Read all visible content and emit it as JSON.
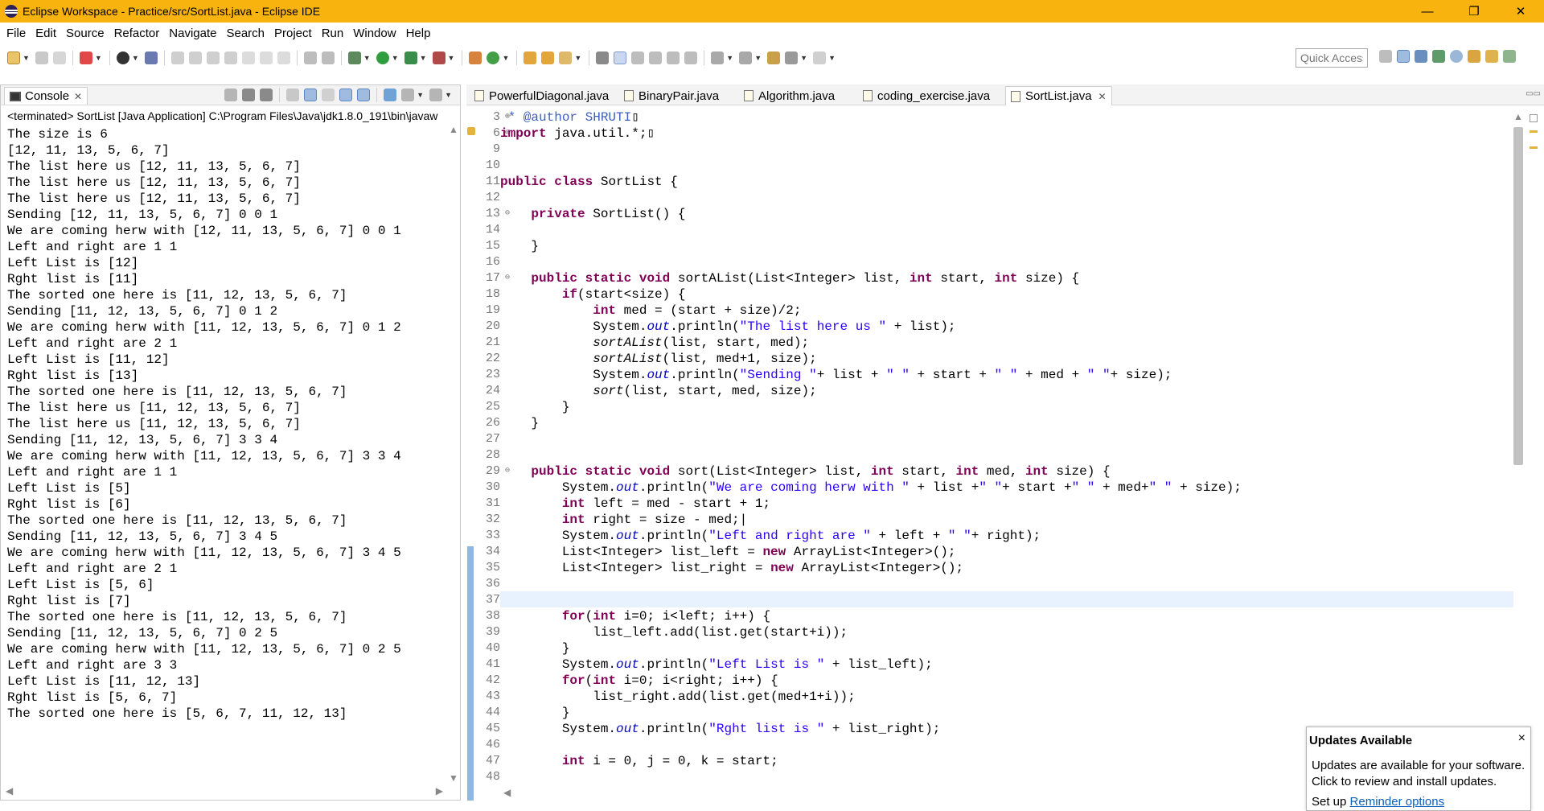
{
  "window": {
    "title": "Eclipse Workspace - Practice/src/SortList.java - Eclipse IDE",
    "min_glyph": "—",
    "max_glyph": "❐",
    "close_glyph": "✕"
  },
  "menu": [
    "File",
    "Edit",
    "Source",
    "Refactor",
    "Navigate",
    "Search",
    "Project",
    "Run",
    "Window",
    "Help"
  ],
  "toolbar": {
    "quick_access_placeholder": "Quick Access"
  },
  "console": {
    "tab_label": "Console",
    "close_glyph": "✕",
    "header": "<terminated> SortList [Java Application] C:\\Program Files\\Java\\jdk1.8.0_191\\bin\\javaw",
    "lines": [
      "The size is 6",
      "[12, 11, 13, 5, 6, 7]",
      "The list here us [12, 11, 13, 5, 6, 7]",
      "The list here us [12, 11, 13, 5, 6, 7]",
      "The list here us [12, 11, 13, 5, 6, 7]",
      "Sending [12, 11, 13, 5, 6, 7] 0 0 1",
      "We are coming herw with [12, 11, 13, 5, 6, 7] 0 0 1",
      "Left and right are 1 1",
      "Left List is [12]",
      "Rght list is [11]",
      "The sorted one here is [11, 12, 13, 5, 6, 7]",
      "Sending [11, 12, 13, 5, 6, 7] 0 1 2",
      "We are coming herw with [11, 12, 13, 5, 6, 7] 0 1 2",
      "Left and right are 2 1",
      "Left List is [11, 12]",
      "Rght list is [13]",
      "The sorted one here is [11, 12, 13, 5, 6, 7]",
      "The list here us [11, 12, 13, 5, 6, 7]",
      "The list here us [11, 12, 13, 5, 6, 7]",
      "Sending [11, 12, 13, 5, 6, 7] 3 3 4",
      "We are coming herw with [11, 12, 13, 5, 6, 7] 3 3 4",
      "Left and right are 1 1",
      "Left List is [5]",
      "Rght list is [6]",
      "The sorted one here is [11, 12, 13, 5, 6, 7]",
      "Sending [11, 12, 13, 5, 6, 7] 3 4 5",
      "We are coming herw with [11, 12, 13, 5, 6, 7] 3 4 5",
      "Left and right are 2 1",
      "Left List is [5, 6]",
      "Rght list is [7]",
      "The sorted one here is [11, 12, 13, 5, 6, 7]",
      "Sending [11, 12, 13, 5, 6, 7] 0 2 5",
      "We are coming herw with [11, 12, 13, 5, 6, 7] 0 2 5",
      "Left and right are 3 3",
      "Left List is [11, 12, 13]",
      "Rght list is [5, 6, 7]",
      "The sorted one here is [5, 6, 7, 11, 12, 13]"
    ]
  },
  "editor": {
    "tabs": [
      {
        "label": "PowerfulDiagonal.java",
        "active": false
      },
      {
        "label": "BinaryPair.java",
        "active": false
      },
      {
        "label": "Algorithm.java",
        "active": false
      },
      {
        "label": "coding_exercise.java",
        "active": false
      },
      {
        "label": "SortList.java",
        "active": true
      }
    ],
    "tab_close_glyph": "✕",
    "current_line_number": "32",
    "lines": [
      {
        "n": "3",
        "fold": "⊕",
        "tokens": [
          {
            "t": " * @author SHRUTI",
            "c": "cm"
          },
          {
            "t": "▯",
            "c": ""
          }
        ]
      },
      {
        "n": "6",
        "fold": "⊕",
        "tokens": [
          {
            "t": "import",
            "c": "kw"
          },
          {
            "t": " java.util.*;",
            "c": ""
          },
          {
            "t": "▯",
            "c": ""
          }
        ]
      },
      {
        "n": "9",
        "tokens": []
      },
      {
        "n": "10",
        "tokens": []
      },
      {
        "n": "11",
        "tokens": [
          {
            "t": "public",
            "c": "kw"
          },
          {
            "t": " ",
            "c": ""
          },
          {
            "t": "class",
            "c": "kw"
          },
          {
            "t": " SortList {",
            "c": ""
          }
        ]
      },
      {
        "n": "12",
        "tokens": []
      },
      {
        "n": "13",
        "fold": "⊖",
        "tokens": [
          {
            "t": "    ",
            "c": ""
          },
          {
            "t": "private",
            "c": "kw"
          },
          {
            "t": " SortList() {",
            "c": ""
          }
        ]
      },
      {
        "n": "14",
        "tokens": []
      },
      {
        "n": "15",
        "tokens": [
          {
            "t": "    }",
            "c": ""
          }
        ]
      },
      {
        "n": "16",
        "tokens": []
      },
      {
        "n": "17",
        "fold": "⊖",
        "tokens": [
          {
            "t": "    ",
            "c": ""
          },
          {
            "t": "public",
            "c": "kw"
          },
          {
            "t": " ",
            "c": ""
          },
          {
            "t": "static",
            "c": "kw"
          },
          {
            "t": " ",
            "c": ""
          },
          {
            "t": "void",
            "c": "kw"
          },
          {
            "t": " sortAList(List<Integer> list, ",
            "c": ""
          },
          {
            "t": "int",
            "c": "kw"
          },
          {
            "t": " start, ",
            "c": ""
          },
          {
            "t": "int",
            "c": "kw"
          },
          {
            "t": " size) {",
            "c": ""
          }
        ]
      },
      {
        "n": "18",
        "tokens": [
          {
            "t": "        ",
            "c": ""
          },
          {
            "t": "if",
            "c": "kw"
          },
          {
            "t": "(start<size) {",
            "c": ""
          }
        ]
      },
      {
        "n": "19",
        "tokens": [
          {
            "t": "            ",
            "c": ""
          },
          {
            "t": "int",
            "c": "kw"
          },
          {
            "t": " med = (start + size)/2;",
            "c": ""
          }
        ]
      },
      {
        "n": "20",
        "tokens": [
          {
            "t": "            System.",
            "c": ""
          },
          {
            "t": "out",
            "c": "fld"
          },
          {
            "t": ".println(",
            "c": ""
          },
          {
            "t": "\"The list here us \"",
            "c": "str"
          },
          {
            "t": " + list);",
            "c": ""
          }
        ]
      },
      {
        "n": "21",
        "tokens": [
          {
            "t": "            ",
            "c": ""
          },
          {
            "t": "sortAList",
            "c": "smeth"
          },
          {
            "t": "(list, start, med);",
            "c": ""
          }
        ]
      },
      {
        "n": "22",
        "tokens": [
          {
            "t": "            ",
            "c": ""
          },
          {
            "t": "sortAList",
            "c": "smeth"
          },
          {
            "t": "(list, med+1, size);",
            "c": ""
          }
        ]
      },
      {
        "n": "23",
        "tokens": [
          {
            "t": "            System.",
            "c": ""
          },
          {
            "t": "out",
            "c": "fld"
          },
          {
            "t": ".println(",
            "c": ""
          },
          {
            "t": "\"Sending \"",
            "c": "str"
          },
          {
            "t": "+ list + ",
            "c": ""
          },
          {
            "t": "\" \"",
            "c": "str"
          },
          {
            "t": " + start + ",
            "c": ""
          },
          {
            "t": "\" \"",
            "c": "str"
          },
          {
            "t": " + med + ",
            "c": ""
          },
          {
            "t": "\" \"",
            "c": "str"
          },
          {
            "t": "+ size);",
            "c": ""
          }
        ]
      },
      {
        "n": "24",
        "tokens": [
          {
            "t": "            ",
            "c": ""
          },
          {
            "t": "sort",
            "c": "smeth"
          },
          {
            "t": "(list, start, med, size);",
            "c": ""
          }
        ]
      },
      {
        "n": "25",
        "tokens": [
          {
            "t": "        }",
            "c": ""
          }
        ]
      },
      {
        "n": "26",
        "tokens": [
          {
            "t": "    }",
            "c": ""
          }
        ]
      },
      {
        "n": "27",
        "tokens": []
      },
      {
        "n": "28",
        "tokens": []
      },
      {
        "n": "29",
        "fold": "⊖",
        "tokens": [
          {
            "t": "    ",
            "c": ""
          },
          {
            "t": "public",
            "c": "kw"
          },
          {
            "t": " ",
            "c": ""
          },
          {
            "t": "static",
            "c": "kw"
          },
          {
            "t": " ",
            "c": ""
          },
          {
            "t": "void",
            "c": "kw"
          },
          {
            "t": " sort(List<Integer> list, ",
            "c": ""
          },
          {
            "t": "int",
            "c": "kw"
          },
          {
            "t": " start, ",
            "c": ""
          },
          {
            "t": "int",
            "c": "kw"
          },
          {
            "t": " med, ",
            "c": ""
          },
          {
            "t": "int",
            "c": "kw"
          },
          {
            "t": " size) {",
            "c": ""
          }
        ]
      },
      {
        "n": "30",
        "tokens": [
          {
            "t": "        System.",
            "c": ""
          },
          {
            "t": "out",
            "c": "fld"
          },
          {
            "t": ".println(",
            "c": ""
          },
          {
            "t": "\"We are coming herw with \"",
            "c": "str"
          },
          {
            "t": " + list +",
            "c": ""
          },
          {
            "t": "\" \"",
            "c": "str"
          },
          {
            "t": "+ start +",
            "c": ""
          },
          {
            "t": "\" \"",
            "c": "str"
          },
          {
            "t": " + med+",
            "c": ""
          },
          {
            "t": "\" \"",
            "c": "str"
          },
          {
            "t": " + size);",
            "c": ""
          }
        ]
      },
      {
        "n": "31",
        "tokens": [
          {
            "t": "        ",
            "c": ""
          },
          {
            "t": "int",
            "c": "kw"
          },
          {
            "t": " left = med - start + 1;",
            "c": ""
          }
        ]
      },
      {
        "n": "32",
        "tokens": [
          {
            "t": "        ",
            "c": ""
          },
          {
            "t": "int",
            "c": "kw"
          },
          {
            "t": " right = size - med;",
            "c": ""
          },
          {
            "t": "|",
            "c": ""
          }
        ]
      },
      {
        "n": "33",
        "tokens": [
          {
            "t": "        System.",
            "c": ""
          },
          {
            "t": "out",
            "c": "fld"
          },
          {
            "t": ".println(",
            "c": ""
          },
          {
            "t": "\"Left and right are \"",
            "c": "str"
          },
          {
            "t": " + left + ",
            "c": ""
          },
          {
            "t": "\" \"",
            "c": "str"
          },
          {
            "t": "+ right);",
            "c": ""
          }
        ]
      },
      {
        "n": "34",
        "tokens": [
          {
            "t": "        List<Integer> list_left = ",
            "c": ""
          },
          {
            "t": "new",
            "c": "kw"
          },
          {
            "t": " ArrayList<Integer>();",
            "c": ""
          }
        ]
      },
      {
        "n": "35",
        "tokens": [
          {
            "t": "        List<Integer> list_right = ",
            "c": ""
          },
          {
            "t": "new",
            "c": "kw"
          },
          {
            "t": " ArrayList<Integer>();",
            "c": ""
          }
        ]
      },
      {
        "n": "36",
        "tokens": []
      },
      {
        "n": "37",
        "tokens": []
      },
      {
        "n": "38",
        "tokens": [
          {
            "t": "        ",
            "c": ""
          },
          {
            "t": "for",
            "c": "kw"
          },
          {
            "t": "(",
            "c": ""
          },
          {
            "t": "int",
            "c": "kw"
          },
          {
            "t": " i=0; i<left; i++) {",
            "c": ""
          }
        ]
      },
      {
        "n": "39",
        "tokens": [
          {
            "t": "            list_left.add(list.get(start+i));",
            "c": ""
          }
        ]
      },
      {
        "n": "40",
        "tokens": [
          {
            "t": "        }",
            "c": ""
          }
        ]
      },
      {
        "n": "41",
        "tokens": [
          {
            "t": "        System.",
            "c": ""
          },
          {
            "t": "out",
            "c": "fld"
          },
          {
            "t": ".println(",
            "c": ""
          },
          {
            "t": "\"Left List is \"",
            "c": "str"
          },
          {
            "t": " + list_left);",
            "c": ""
          }
        ]
      },
      {
        "n": "42",
        "tokens": [
          {
            "t": "        ",
            "c": ""
          },
          {
            "t": "for",
            "c": "kw"
          },
          {
            "t": "(",
            "c": ""
          },
          {
            "t": "int",
            "c": "kw"
          },
          {
            "t": " i=0; i<right; i++) {",
            "c": ""
          }
        ]
      },
      {
        "n": "43",
        "tokens": [
          {
            "t": "            list_right.add(list.get(med+1+i));",
            "c": ""
          }
        ]
      },
      {
        "n": "44",
        "tokens": [
          {
            "t": "        }",
            "c": ""
          }
        ]
      },
      {
        "n": "45",
        "tokens": [
          {
            "t": "        System.",
            "c": ""
          },
          {
            "t": "out",
            "c": "fld"
          },
          {
            "t": ".println(",
            "c": ""
          },
          {
            "t": "\"Rght list is \"",
            "c": "str"
          },
          {
            "t": " + list_right);",
            "c": ""
          }
        ]
      },
      {
        "n": "46",
        "tokens": []
      },
      {
        "n": "47",
        "tokens": [
          {
            "t": "        ",
            "c": ""
          },
          {
            "t": "int",
            "c": "kw"
          },
          {
            "t": " i = 0, j = 0, k = start;",
            "c": ""
          }
        ]
      },
      {
        "n": "48",
        "tokens": []
      }
    ]
  },
  "notification": {
    "title": "Updates Available",
    "close_glyph": "×",
    "line1": "Updates are available for your software.",
    "line2": "Click to review and install updates.",
    "line3_prefix": "Set up ",
    "link": "Reminder options"
  },
  "colors": {
    "titlebar": "#f9b30f",
    "keyword": "#7f0055",
    "string": "#2a00ff",
    "field": "#0000c0",
    "comment": "#3f5fbf",
    "current_line": "#e8f2fe",
    "link": "#0a5ebd"
  }
}
